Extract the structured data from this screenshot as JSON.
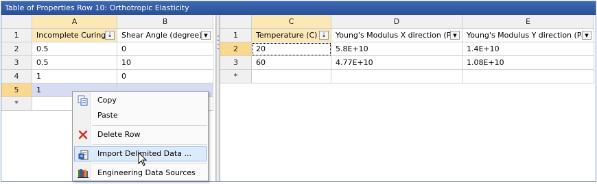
{
  "window": {
    "title": "Table of Properties Row 10: Orthotropic Elasticity"
  },
  "left_table": {
    "column_letters": [
      "A",
      "B"
    ],
    "column_names": [
      "Incomplete Curing",
      "Shear Angle (degree)"
    ],
    "rows": [
      {
        "num": "2",
        "a": "0.5",
        "b": "0"
      },
      {
        "num": "3",
        "a": "0.5",
        "b": "10"
      },
      {
        "num": "4",
        "a": "1",
        "b": "0"
      },
      {
        "num": "5",
        "a": "1",
        "b": ""
      }
    ],
    "header_row_num": "1",
    "new_row_marker": "*"
  },
  "right_table": {
    "column_letters": [
      "C",
      "D",
      "E"
    ],
    "column_names": [
      "Temperature (C)",
      "Young's Modulus X direction (Pa)",
      "Young's Modulus Y direction (Pa)"
    ],
    "rows": [
      {
        "num": "2",
        "c": "20",
        "d": "5.8E+10",
        "e": "1.4E+10"
      },
      {
        "num": "3",
        "c": "60",
        "d": "4.77E+10",
        "e": "1.08E+10"
      }
    ],
    "header_row_num": "1",
    "new_row_marker": "*"
  },
  "context_menu": {
    "items": [
      {
        "label": "Copy",
        "icon": "copy-icon"
      },
      {
        "label": "Paste",
        "icon": ""
      },
      {
        "label": "Delete Row",
        "icon": "delete-icon"
      },
      {
        "label": "Import Delimited Data ...",
        "icon": "import-icon"
      },
      {
        "label": "Engineering Data Sources",
        "icon": "library-icon"
      }
    ],
    "highlighted_index": 3
  },
  "colors": {
    "title_bar": "#2f5aa8",
    "selected_column_header": "#fbe8b6",
    "selected_row_number": "#f9d88f",
    "selected_cell": "#d8dcf2",
    "menu_highlight": "#dcebfb"
  }
}
